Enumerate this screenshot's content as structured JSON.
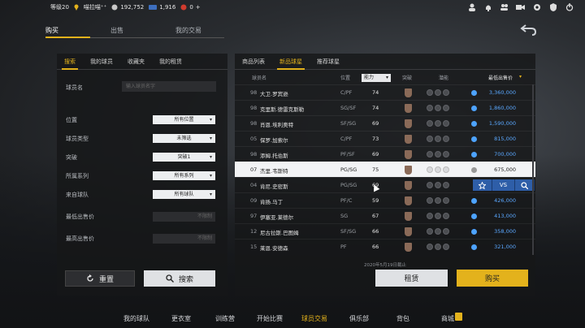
{
  "topbar": {
    "level": "等级20",
    "username": "喵拉喵⁺⁺",
    "coins": "192,752",
    "points": "1,916",
    "tickets": "0",
    "plus": "+"
  },
  "main_tabs": [
    "购买",
    "出售",
    "我的交易"
  ],
  "left_panel": {
    "tabs": [
      "搜索",
      "我的球员",
      "收藏夹",
      "我的租赁"
    ],
    "player_name_label": "球员名",
    "player_name_placeholder": "输入球员名字",
    "filters": [
      {
        "label": "位置",
        "value": "所有位置"
      },
      {
        "label": "球员类型",
        "value": "未筛选"
      },
      {
        "label": "突破",
        "value": "突破1"
      },
      {
        "label": "所属系列",
        "value": "所有系列"
      },
      {
        "label": "来自球队",
        "value": "所有球队"
      }
    ],
    "min_price_label": "最低出售价",
    "min_price_placeholder": "不限制",
    "max_price_label": "最高出售价",
    "max_price_placeholder": "不限制",
    "reset_label": "重置",
    "search_label": "搜索"
  },
  "right_panel": {
    "tabs": [
      "商品列表",
      "新品球星",
      "推荐球星"
    ],
    "headers": {
      "player": "球员名",
      "position": "位置",
      "ability": "能力",
      "breakthrough": "突破",
      "skills": "潜能",
      "price": "最低出售价"
    },
    "rows": [
      {
        "rating": "98",
        "name": "大卫.罗宾逊",
        "pos": "C/PF",
        "ability": "74",
        "price": "3,360,000"
      },
      {
        "rating": "98",
        "name": "克里斯.德雷克斯勒",
        "pos": "SG/SF",
        "ability": "74",
        "price": "1,860,000"
      },
      {
        "rating": "98",
        "name": "肖恩.埃利奥特",
        "pos": "SF/SG",
        "ability": "69",
        "price": "1,590,000"
      },
      {
        "rating": "05",
        "name": "保罗.加索尔",
        "pos": "C/PF",
        "ability": "73",
        "price": "815,000"
      },
      {
        "rating": "98",
        "name": "添姆.托伯斯",
        "pos": "PF/SF",
        "ability": "69",
        "price": "700,000"
      },
      {
        "rating": "07",
        "name": "杰里.韦斯特",
        "pos": "PG/SG",
        "ability": "75",
        "price": "675,000"
      },
      {
        "rating": "04",
        "name": "肯尼.史密斯",
        "pos": "PG/SG",
        "ability": "69",
        "price": ""
      },
      {
        "rating": "09",
        "name": "肯扬.马丁",
        "pos": "PF/C",
        "ability": "59",
        "price": "426,000"
      },
      {
        "rating": "97",
        "name": "伊塞亚.莱德尔",
        "pos": "SG",
        "ability": "67",
        "price": "413,000"
      },
      {
        "rating": "12",
        "name": "尼古拉斯.巴图姆",
        "pos": "SF/SG",
        "ability": "66",
        "price": "358,000"
      },
      {
        "rating": "15",
        "name": "莱恩.安德森",
        "pos": "PF",
        "ability": "66",
        "price": "321,000"
      }
    ],
    "selected_index": 5,
    "action_vs": "VS",
    "date_note": "2020年5月19日截止",
    "rent_label": "租赁",
    "buy_label": "购买"
  },
  "bottom_nav": [
    "我的球队",
    "更衣室",
    "训练营",
    "开始比赛",
    "球员交易",
    "俱乐部",
    "背包",
    "商城"
  ],
  "bottom_nav_active": "球员交易",
  "colors": {
    "accent": "#e3b21c",
    "price_blue": "#5aa8ff",
    "action_blue": "#2e5ea8"
  }
}
